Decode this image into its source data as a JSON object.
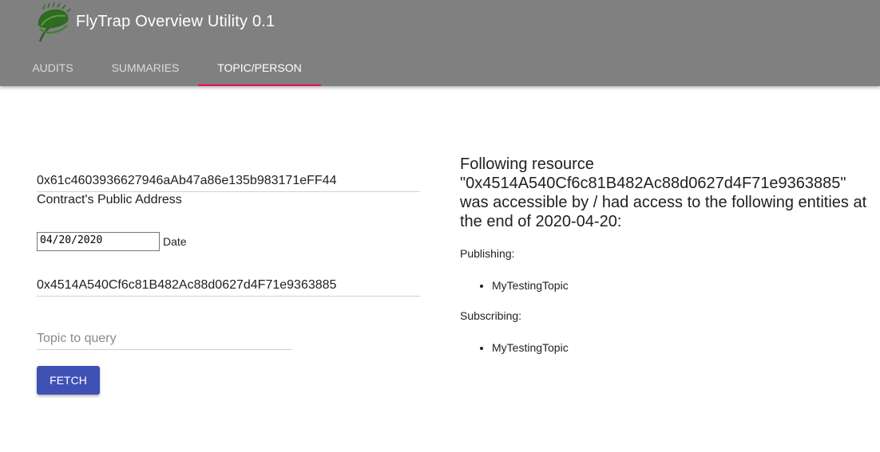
{
  "app": {
    "title": "FlyTrap Overview Utility 0.1",
    "logo_icon": "venus-flytrap-icon"
  },
  "tabs": [
    {
      "label": "AUDITS",
      "active": false
    },
    {
      "label": "SUMMARIES",
      "active": false
    },
    {
      "label": "TOPIC/PERSON",
      "active": true
    }
  ],
  "form": {
    "contract_address": {
      "value": "0x61c4603936627946aAb47a86e135b983171eFF44",
      "helper": "Contract's Public Address"
    },
    "date": {
      "value": "04/20/2020",
      "label": "Date"
    },
    "person_address": {
      "value": "0x4514A540Cf6c81B482Ac88d0627d4F71e9363885"
    },
    "topic": {
      "placeholder": "Topic to query",
      "value": ""
    },
    "fetch_label": "FETCH"
  },
  "result": {
    "heading": "Following resource \"0x4514A540Cf6c81B482Ac88d0627d4F71e9363885\" was accessible by / had access to the following entities at the end of 2020-04-20:",
    "publishing_label": "Publishing:",
    "publishing": [
      "MyTestingTopic"
    ],
    "subscribing_label": "Subscribing:",
    "subscribing": [
      "MyTestingTopic"
    ]
  },
  "colors": {
    "appbar": "#808080",
    "indicator": "#f50057",
    "primary_button": "#3f51b5"
  }
}
